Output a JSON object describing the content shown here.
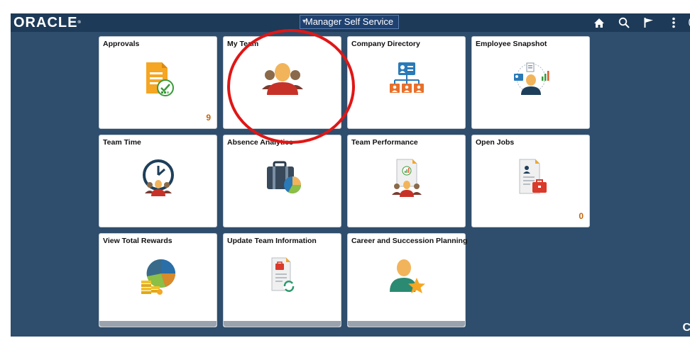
{
  "header": {
    "brand": "ORACLE",
    "home_title": "Manager Self Service",
    "icons": [
      "home-icon",
      "search-icon",
      "flag-icon",
      "more-options-icon"
    ]
  },
  "tiles": [
    {
      "title": "Approvals",
      "icon": "approvals-icon",
      "count": "9"
    },
    {
      "title": "My Team",
      "icon": "my-team-icon"
    },
    {
      "title": "Company Directory",
      "icon": "company-directory-icon"
    },
    {
      "title": "Employee Snapshot",
      "icon": "employee-snapshot-icon"
    },
    {
      "title": "Team Time",
      "icon": "team-time-icon"
    },
    {
      "title": "Absence Analytics",
      "icon": "absence-analytics-icon"
    },
    {
      "title": "Team Performance",
      "icon": "team-performance-icon"
    },
    {
      "title": "Open Jobs",
      "icon": "open-jobs-icon",
      "count": "0"
    },
    {
      "title": "View Total Rewards",
      "icon": "total-rewards-icon"
    },
    {
      "title": "Update Team Information",
      "icon": "update-team-info-icon"
    },
    {
      "title": "Career and Succession Planning",
      "icon": "career-succession-icon"
    }
  ],
  "colors": {
    "background": "#2f4d6c",
    "header": "#1d3a58",
    "badge": "#c0650c",
    "annotation": "#e01616"
  }
}
